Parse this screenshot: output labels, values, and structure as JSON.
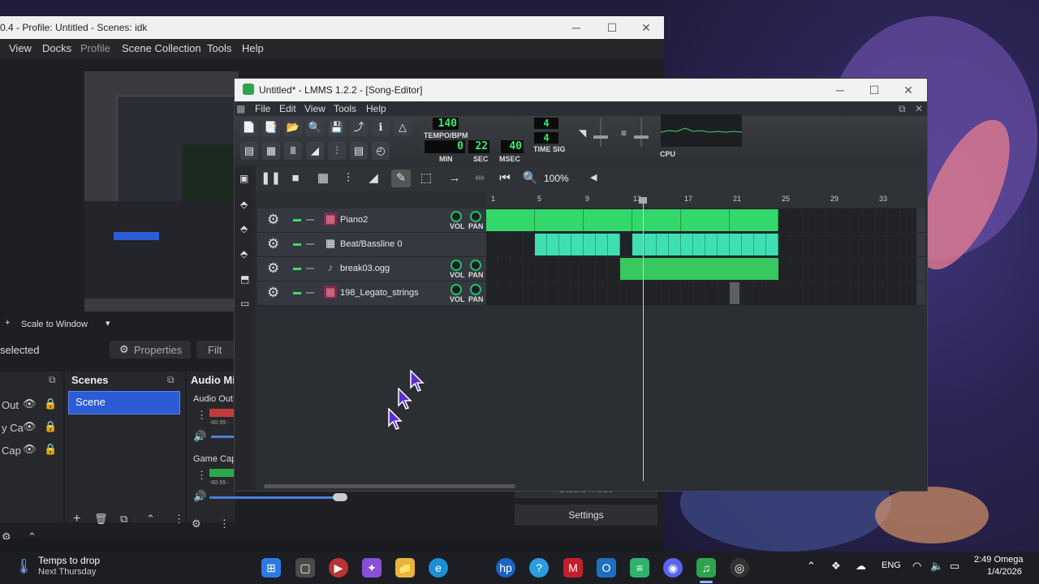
{
  "obs": {
    "title": "0.4 - Profile: Untitled - Scenes: idk",
    "menu": [
      "View",
      "Docks",
      "Profile",
      "Scene Collection",
      "Tools",
      "Help"
    ],
    "scale_label": "Scale to Window",
    "selected_label": "selected",
    "properties_label": "Properties",
    "filters_label": "Filt",
    "scenes_title": "Scenes",
    "audio_title": "Audio Mi",
    "scene_item": "Scene",
    "sources": [
      "Out",
      "y Ca",
      "Cap"
    ],
    "audio_channels": [
      {
        "name": "Audio Out",
        "db": "-60-55 -"
      },
      {
        "name": "Game Cap",
        "db": "-60-55 -"
      }
    ],
    "studio_mode": "Studio Mode",
    "settings": "Settings"
  },
  "lmms": {
    "title": "Untitled* - LMMS 1.2.2 - [Song-Editor]",
    "menu": [
      "File",
      "Edit",
      "View",
      "Tools",
      "Help"
    ],
    "tempo": "140",
    "tempo_label": "TEMPO/BPM",
    "time_min": "0",
    "time_sec": "22",
    "time_msec": "40",
    "min_label": "MIN",
    "sec_label": "SEC",
    "msec_label": "MSEC",
    "timesig_num": "4",
    "timesig_den": "4",
    "timesig_label": "TIME SIG",
    "cpu_label": "CPU",
    "zoom": "100%",
    "ruler": [
      "1",
      "5",
      "9",
      "13",
      "17",
      "21",
      "25",
      "29",
      "33"
    ],
    "vol_label": "VOL",
    "pan_label": "PAN",
    "tracks": [
      {
        "name": "Piano2",
        "type": "instrument"
      },
      {
        "name": "Beat/Bassline 0",
        "type": "beat"
      },
      {
        "name": "break03.ogg",
        "type": "sample"
      },
      {
        "name": "198_Legato_strings",
        "type": "instrument"
      }
    ]
  },
  "taskbar": {
    "weather_title": "Temps to drop",
    "weather_sub": "Next Thursday",
    "lang": "ENG",
    "time": "2:49 Omega",
    "date": "1/4/2026"
  },
  "colors": {
    "lmms_green": "#33d86a",
    "bb_teal": "#3ee0b3",
    "obs_blue": "#2b5cd6"
  }
}
